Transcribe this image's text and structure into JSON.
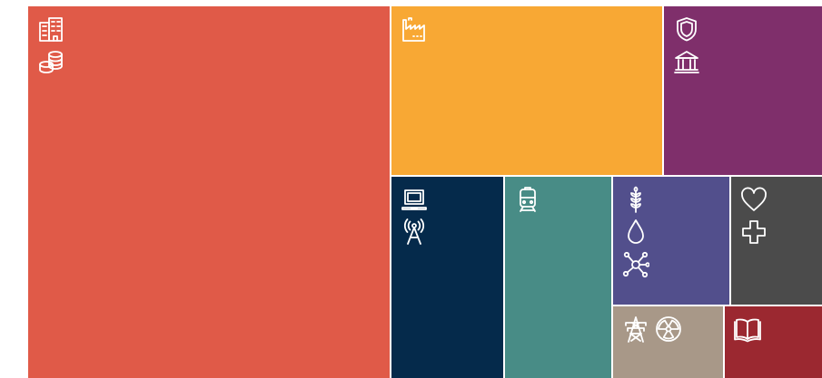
{
  "chart_data": {
    "type": "treemap",
    "title": "",
    "tiles": [
      {
        "id": "property-finance",
        "color": "#e05a48",
        "icons": [
          "buildings-icon",
          "coins-icon"
        ]
      },
      {
        "id": "industry",
        "color": "#f8a834",
        "icons": [
          "factory-icon"
        ]
      },
      {
        "id": "government",
        "color": "#7f2f6b",
        "icons": [
          "shield-icon",
          "bank-icon"
        ]
      },
      {
        "id": "ict-telecom",
        "color": "#052a4b",
        "icons": [
          "laptop-icon",
          "antenna-icon"
        ]
      },
      {
        "id": "transport",
        "color": "#488c86",
        "icons": [
          "train-icon"
        ]
      },
      {
        "id": "agri-water-chemicals",
        "color": "#524f8c",
        "icons": [
          "wheat-icon",
          "water-drop-icon",
          "molecule-icon"
        ]
      },
      {
        "id": "health",
        "color": "#4b4b4b",
        "icons": [
          "heart-icon",
          "medical-cross-icon"
        ]
      },
      {
        "id": "energy",
        "color": "#a89888",
        "icons": [
          "power-pylon-icon",
          "radiation-icon"
        ]
      },
      {
        "id": "education",
        "color": "#9b2830",
        "icons": [
          "book-icon"
        ]
      }
    ]
  }
}
